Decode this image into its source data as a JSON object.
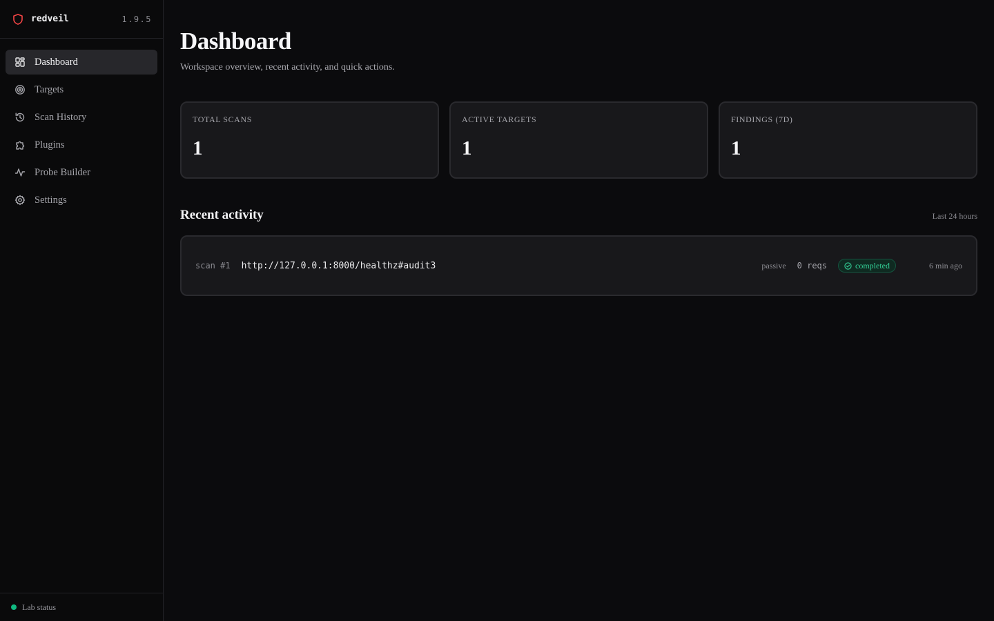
{
  "brand": {
    "name": "redveil",
    "version": "1.9.5",
    "accent_color": "#ef4444",
    "logo_icon": "shield-icon"
  },
  "sidebar": {
    "items": [
      {
        "label": "Dashboard",
        "icon": "dashboard-grid-icon",
        "active": true
      },
      {
        "label": "Targets",
        "icon": "target-icon",
        "active": false
      },
      {
        "label": "Scan History",
        "icon": "history-icon",
        "active": false
      },
      {
        "label": "Plugins",
        "icon": "puzzle-icon",
        "active": false
      },
      {
        "label": "Probe Builder",
        "icon": "waveform-icon",
        "active": false
      },
      {
        "label": "Settings",
        "icon": "gear-icon",
        "active": false
      }
    ],
    "footer": {
      "status_label": "Lab status",
      "status_color": "#10b981"
    }
  },
  "header": {
    "title": "Dashboard",
    "subtitle": "Workspace overview, recent activity, and quick actions."
  },
  "stats": [
    {
      "label": "TOTAL SCANS",
      "value": "1"
    },
    {
      "label": "ACTIVE TARGETS",
      "value": "1"
    },
    {
      "label": "FINDINGS (7D)",
      "value": "1"
    }
  ],
  "activity": {
    "title": "Recent activity",
    "range": "Last 24 hours",
    "items": [
      {
        "scan_id": "scan #1",
        "url": "http://127.0.0.1:8000/healthz#audit3",
        "mode": "passive",
        "requests": "0 reqs",
        "status": "completed",
        "status_color": "#34d399",
        "time": "6 min ago"
      }
    ]
  }
}
